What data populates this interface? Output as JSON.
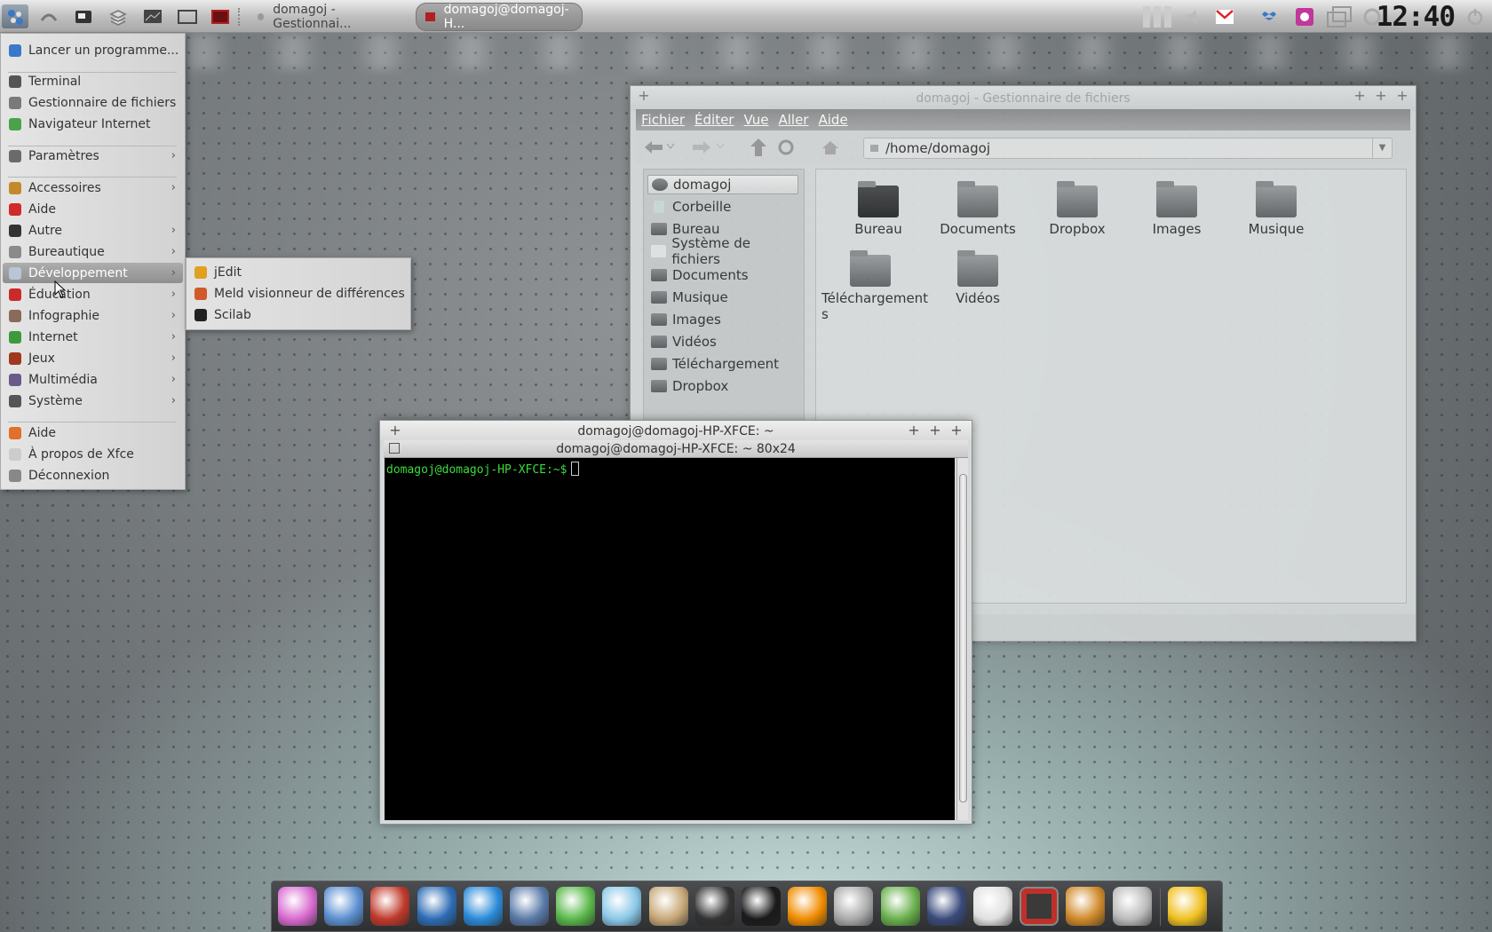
{
  "taskbar": {
    "tasks": [
      {
        "label": "domagoj - Gestionnai..."
      },
      {
        "label": "domagoj@domagoj-H..."
      }
    ],
    "clock": "12:40"
  },
  "app_menu": {
    "items": [
      {
        "label": "Lancer un programme...",
        "icon": "run-icon",
        "color": "#3a78c8"
      },
      {
        "label": "Terminal",
        "icon": "terminal-icon",
        "color": "#555555"
      },
      {
        "label": "Gestionnaire de fichiers",
        "icon": "file-manager-icon",
        "color": "#7a7a7a"
      },
      {
        "label": "Navigateur Internet",
        "icon": "globe-icon",
        "color": "#4aa34a"
      },
      {
        "label": "Paramètres",
        "icon": "settings-icon",
        "color": "#6b6b6b",
        "submenu": true
      },
      {
        "label": "Accessoires",
        "icon": "accessories-icon",
        "color": "#c28a2a",
        "submenu": true
      },
      {
        "label": "Aide",
        "icon": "help-icon",
        "color": "#d02a2a"
      },
      {
        "label": "Autre",
        "icon": "star-icon",
        "color": "#333333",
        "submenu": true
      },
      {
        "label": "Bureautique",
        "icon": "office-icon",
        "color": "#8a8a8a",
        "submenu": true
      },
      {
        "label": "Développement",
        "icon": "development-icon",
        "color": "#b8c6d8",
        "submenu": true
      },
      {
        "label": "Éducation",
        "icon": "education-icon",
        "color": "#cc2a2a",
        "submenu": true
      },
      {
        "label": "Infographie",
        "icon": "graphics-icon",
        "color": "#8a6a5a",
        "submenu": true
      },
      {
        "label": "Internet",
        "icon": "internet-icon",
        "color": "#3c9a3c",
        "submenu": true
      },
      {
        "label": "Jeux",
        "icon": "games-icon",
        "color": "#a0381e",
        "submenu": true
      },
      {
        "label": "Multimédia",
        "icon": "multimedia-icon",
        "color": "#6a5a8a",
        "submenu": true
      },
      {
        "label": "Système",
        "icon": "system-icon",
        "color": "#555555",
        "submenu": true
      },
      {
        "label": "Aide",
        "icon": "help-icon",
        "color": "#e0702a"
      },
      {
        "label": "À propos de Xfce",
        "icon": "about-icon",
        "color": "#cccccc"
      },
      {
        "label": "Déconnexion",
        "icon": "logout-icon",
        "color": "#888888"
      }
    ],
    "submenu": {
      "items": [
        {
          "label": "jEdit",
          "icon": "jedit-icon",
          "color": "#e0a020"
        },
        {
          "label": "Meld visionneur de différences",
          "icon": "meld-icon",
          "color": "#d05a2a"
        },
        {
          "label": "Scilab",
          "icon": "scilab-icon",
          "color": "#222222"
        }
      ]
    }
  },
  "file_manager": {
    "title": "domagoj - Gestionnaire de fichiers",
    "menu": [
      "Fichier",
      "Éditer",
      "Vue",
      "Aller",
      "Aide"
    ],
    "path": "/home/domagoj",
    "sidebar": [
      "domagoj",
      "Corbeille",
      "Bureau",
      "Système de fichiers",
      "Documents",
      "Musique",
      "Images",
      "Vidéos",
      "Téléchargement",
      "Dropbox"
    ],
    "folders": [
      "Bureau",
      "Documents",
      "Dropbox",
      "Images",
      "Musique",
      "Téléchargement\ns",
      "Vidéos"
    ]
  },
  "terminal": {
    "title": "domagoj@domagoj-HP-XFCE: ~",
    "tab": "domagoj@domagoj-HP-XFCE: ~ 80x24",
    "prompt": "domagoj@domagoj-HP-XFCE:~$"
  },
  "dock": {
    "apps": [
      {
        "name": "settings-manager-icon",
        "color": "#d86ad0"
      },
      {
        "name": "chromium-icon",
        "color": "#5b8fd0"
      },
      {
        "name": "calendar-icon",
        "color": "#c0392b"
      },
      {
        "name": "google-earth-icon",
        "color": "#2d6cb5"
      },
      {
        "name": "messenger-icon",
        "color": "#2a8ad8"
      },
      {
        "name": "inkscape-icon",
        "color": "#5a7aa8"
      },
      {
        "name": "feather-icon",
        "color": "#5ab84a"
      },
      {
        "name": "notepad-icon",
        "color": "#8ac8e8"
      },
      {
        "name": "gimp-icon",
        "color": "#c8a878"
      },
      {
        "name": "pen-icon",
        "color": "#333333"
      },
      {
        "name": "disc-icon",
        "color": "#1a1a1a"
      },
      {
        "name": "vlc-icon",
        "color": "#f08c00"
      },
      {
        "name": "headphones-icon",
        "color": "#aaaaaa"
      },
      {
        "name": "qgis-icon",
        "color": "#6ab04c"
      },
      {
        "name": "update-icon",
        "color": "#3a4a7a"
      },
      {
        "name": "keyboard-icon",
        "color": "#e0e0e0"
      },
      {
        "name": "terminal-dock-icon",
        "color": "#c0302a"
      },
      {
        "name": "cleaner-icon",
        "color": "#d08a2a"
      },
      {
        "name": "shell-icon",
        "color": "#bbbbbb"
      },
      {
        "name": "weather-icon",
        "color": "#f0c020"
      }
    ]
  }
}
